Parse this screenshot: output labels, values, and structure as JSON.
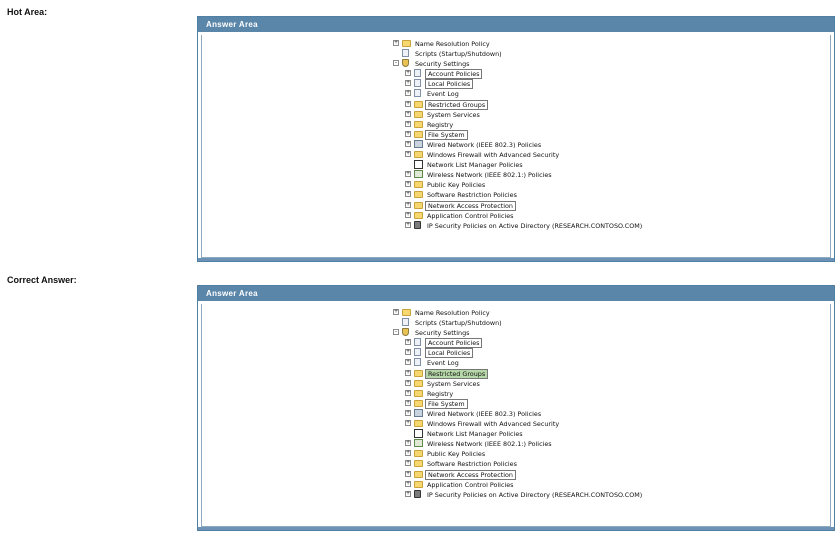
{
  "sections": [
    {
      "label": "Hot Area:",
      "panel_title": "Answer Area",
      "items": [
        {
          "label": "Name Resolution Policy",
          "level": 0,
          "expander": "+",
          "icon": "folder-icon",
          "boxed": false,
          "correct": false
        },
        {
          "label": "Scripts (Startup/Shutdown)",
          "level": 0,
          "expander": "",
          "icon": "document-icon",
          "boxed": false,
          "correct": false
        },
        {
          "label": "Security Settings",
          "level": 0,
          "expander": "-",
          "icon": "security-settings-icon",
          "boxed": false,
          "correct": false
        },
        {
          "label": "Account Policies",
          "level": 1,
          "expander": "+",
          "icon": "document-icon",
          "boxed": true,
          "correct": false
        },
        {
          "label": "Local Policies",
          "level": 1,
          "expander": "+",
          "icon": "document-icon",
          "boxed": true,
          "correct": false
        },
        {
          "label": "Event Log",
          "level": 1,
          "expander": "+",
          "icon": "document-icon",
          "boxed": false,
          "correct": false
        },
        {
          "label": "Restricted Groups",
          "level": 1,
          "expander": "+",
          "icon": "folder-icon",
          "boxed": true,
          "correct": false
        },
        {
          "label": "System Services",
          "level": 1,
          "expander": "+",
          "icon": "folder-icon",
          "boxed": false,
          "correct": false
        },
        {
          "label": "Registry",
          "level": 1,
          "expander": "+",
          "icon": "folder-icon",
          "boxed": false,
          "correct": false
        },
        {
          "label": "File System",
          "level": 1,
          "expander": "+",
          "icon": "folder-icon",
          "boxed": true,
          "correct": false
        },
        {
          "label": "Wired Network (IEEE 802.3) Policies",
          "level": 1,
          "expander": "+",
          "icon": "wired-network-icon",
          "boxed": false,
          "correct": false
        },
        {
          "label": "Windows Firewall with Advanced Security",
          "level": 1,
          "expander": "+",
          "icon": "folder-icon",
          "boxed": false,
          "correct": false
        },
        {
          "label": "Network List Manager Policies",
          "level": 1,
          "expander": "",
          "icon": "blank-icon",
          "boxed": false,
          "correct": false
        },
        {
          "label": "Wireless Network (IEEE 802.1:) Policies",
          "level": 1,
          "expander": "+",
          "icon": "wireless-network-icon",
          "boxed": false,
          "correct": false
        },
        {
          "label": "Public Key Policies",
          "level": 1,
          "expander": "+",
          "icon": "folder-icon",
          "boxed": false,
          "correct": false
        },
        {
          "label": "Software Restriction Policies",
          "level": 1,
          "expander": "+",
          "icon": "folder-icon",
          "boxed": false,
          "correct": false
        },
        {
          "label": "Network Access Protection",
          "level": 1,
          "expander": "+",
          "icon": "folder-icon",
          "boxed": true,
          "correct": false
        },
        {
          "label": "Application Control Policies",
          "level": 1,
          "expander": "+",
          "icon": "folder-icon",
          "boxed": false,
          "correct": false
        },
        {
          "label": "IP Security Policies on Active Directory (RESEARCH.CONTOSO.COM)",
          "level": 1,
          "expander": "+",
          "icon": "ip-security-icon",
          "boxed": false,
          "correct": false
        }
      ]
    },
    {
      "label": "Correct Answer:",
      "panel_title": "Answer Area",
      "items": [
        {
          "label": "Name Resolution Policy",
          "level": 0,
          "expander": "+",
          "icon": "folder-icon",
          "boxed": false,
          "correct": false
        },
        {
          "label": "Scripts (Startup/Shutdown)",
          "level": 0,
          "expander": "",
          "icon": "document-icon",
          "boxed": false,
          "correct": false
        },
        {
          "label": "Security Settings",
          "level": 0,
          "expander": "-",
          "icon": "security-settings-icon",
          "boxed": false,
          "correct": false
        },
        {
          "label": "Account Policies",
          "level": 1,
          "expander": "+",
          "icon": "document-icon",
          "boxed": true,
          "correct": false
        },
        {
          "label": "Local Policies",
          "level": 1,
          "expander": "+",
          "icon": "document-icon",
          "boxed": true,
          "correct": false
        },
        {
          "label": "Event Log",
          "level": 1,
          "expander": "+",
          "icon": "document-icon",
          "boxed": false,
          "correct": false
        },
        {
          "label": "Restricted Groups",
          "level": 1,
          "expander": "+",
          "icon": "folder-icon",
          "boxed": true,
          "correct": true
        },
        {
          "label": "System Services",
          "level": 1,
          "expander": "+",
          "icon": "folder-icon",
          "boxed": false,
          "correct": false
        },
        {
          "label": "Registry",
          "level": 1,
          "expander": "+",
          "icon": "folder-icon",
          "boxed": false,
          "correct": false
        },
        {
          "label": "File System",
          "level": 1,
          "expander": "+",
          "icon": "folder-icon",
          "boxed": true,
          "correct": false
        },
        {
          "label": "Wired Network (IEEE 802.3) Policies",
          "level": 1,
          "expander": "+",
          "icon": "wired-network-icon",
          "boxed": false,
          "correct": false
        },
        {
          "label": "Windows Firewall with Advanced Security",
          "level": 1,
          "expander": "+",
          "icon": "folder-icon",
          "boxed": false,
          "correct": false
        },
        {
          "label": "Network List Manager Policies",
          "level": 1,
          "expander": "",
          "icon": "blank-icon",
          "boxed": false,
          "correct": false
        },
        {
          "label": "Wireless Network (IEEE 802.1:) Policies",
          "level": 1,
          "expander": "+",
          "icon": "wireless-network-icon",
          "boxed": false,
          "correct": false
        },
        {
          "label": "Public Key Policies",
          "level": 1,
          "expander": "+",
          "icon": "folder-icon",
          "boxed": false,
          "correct": false
        },
        {
          "label": "Software Restriction Policies",
          "level": 1,
          "expander": "+",
          "icon": "folder-icon",
          "boxed": false,
          "correct": false
        },
        {
          "label": "Network Access Protection",
          "level": 1,
          "expander": "+",
          "icon": "folder-icon",
          "boxed": true,
          "correct": false
        },
        {
          "label": "Application Control Policies",
          "level": 1,
          "expander": "+",
          "icon": "folder-icon",
          "boxed": false,
          "correct": false
        },
        {
          "label": "IP Security Policies on Active Directory (RESEARCH.CONTOSO.COM)",
          "level": 1,
          "expander": "+",
          "icon": "ip-security-icon",
          "boxed": false,
          "correct": false
        }
      ]
    }
  ],
  "colors": {
    "panel_header": "#5a86aa",
    "panel_border": "#4f7fa3",
    "correct_highlight": "#b6d7a8",
    "folder": "#f6d770"
  }
}
